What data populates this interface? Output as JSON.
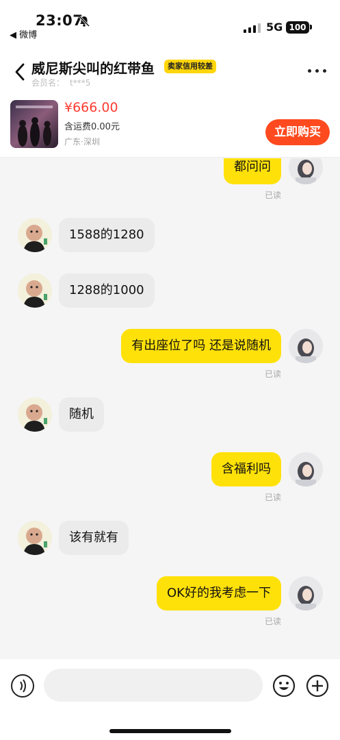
{
  "status_bar": {
    "time": "23:07",
    "back_app": "◀ 微博",
    "network": "5G",
    "battery": "100"
  },
  "header": {
    "seller_name": "威尼斯尖叫的红带鱼",
    "credit_badge": "卖家信用较差",
    "member_label": "会员名：",
    "member_id": "t***5",
    "price": "¥666.00",
    "shipping": "含运费0.00元",
    "location": "广东·深圳",
    "buy_button": "立即购买"
  },
  "messages": [
    {
      "side": "out",
      "text": "都问问",
      "read": "已读"
    },
    {
      "side": "in",
      "text": "1588的1280"
    },
    {
      "side": "in",
      "text": "1288的1000"
    },
    {
      "side": "out",
      "text": "有出座位了吗 还是说随机",
      "read": "已读"
    },
    {
      "side": "in",
      "text": "随机"
    },
    {
      "side": "out",
      "text": "含福利吗",
      "read": "已读"
    },
    {
      "side": "in",
      "text": "该有就有"
    },
    {
      "side": "out",
      "text": "OK好的我考虑一下",
      "read": "已读"
    }
  ],
  "input": {
    "placeholder": ""
  },
  "colors": {
    "accent_yellow": "#ffe10a",
    "buy_red": "#ff4a1f",
    "price_red": "#ff3b30",
    "incoming_bubble": "#ebebeb"
  },
  "icons": [
    "bell-off-icon",
    "signal-icon",
    "back-arrow-icon",
    "more-icon",
    "voice-icon",
    "emoji-icon",
    "plus-icon"
  ]
}
